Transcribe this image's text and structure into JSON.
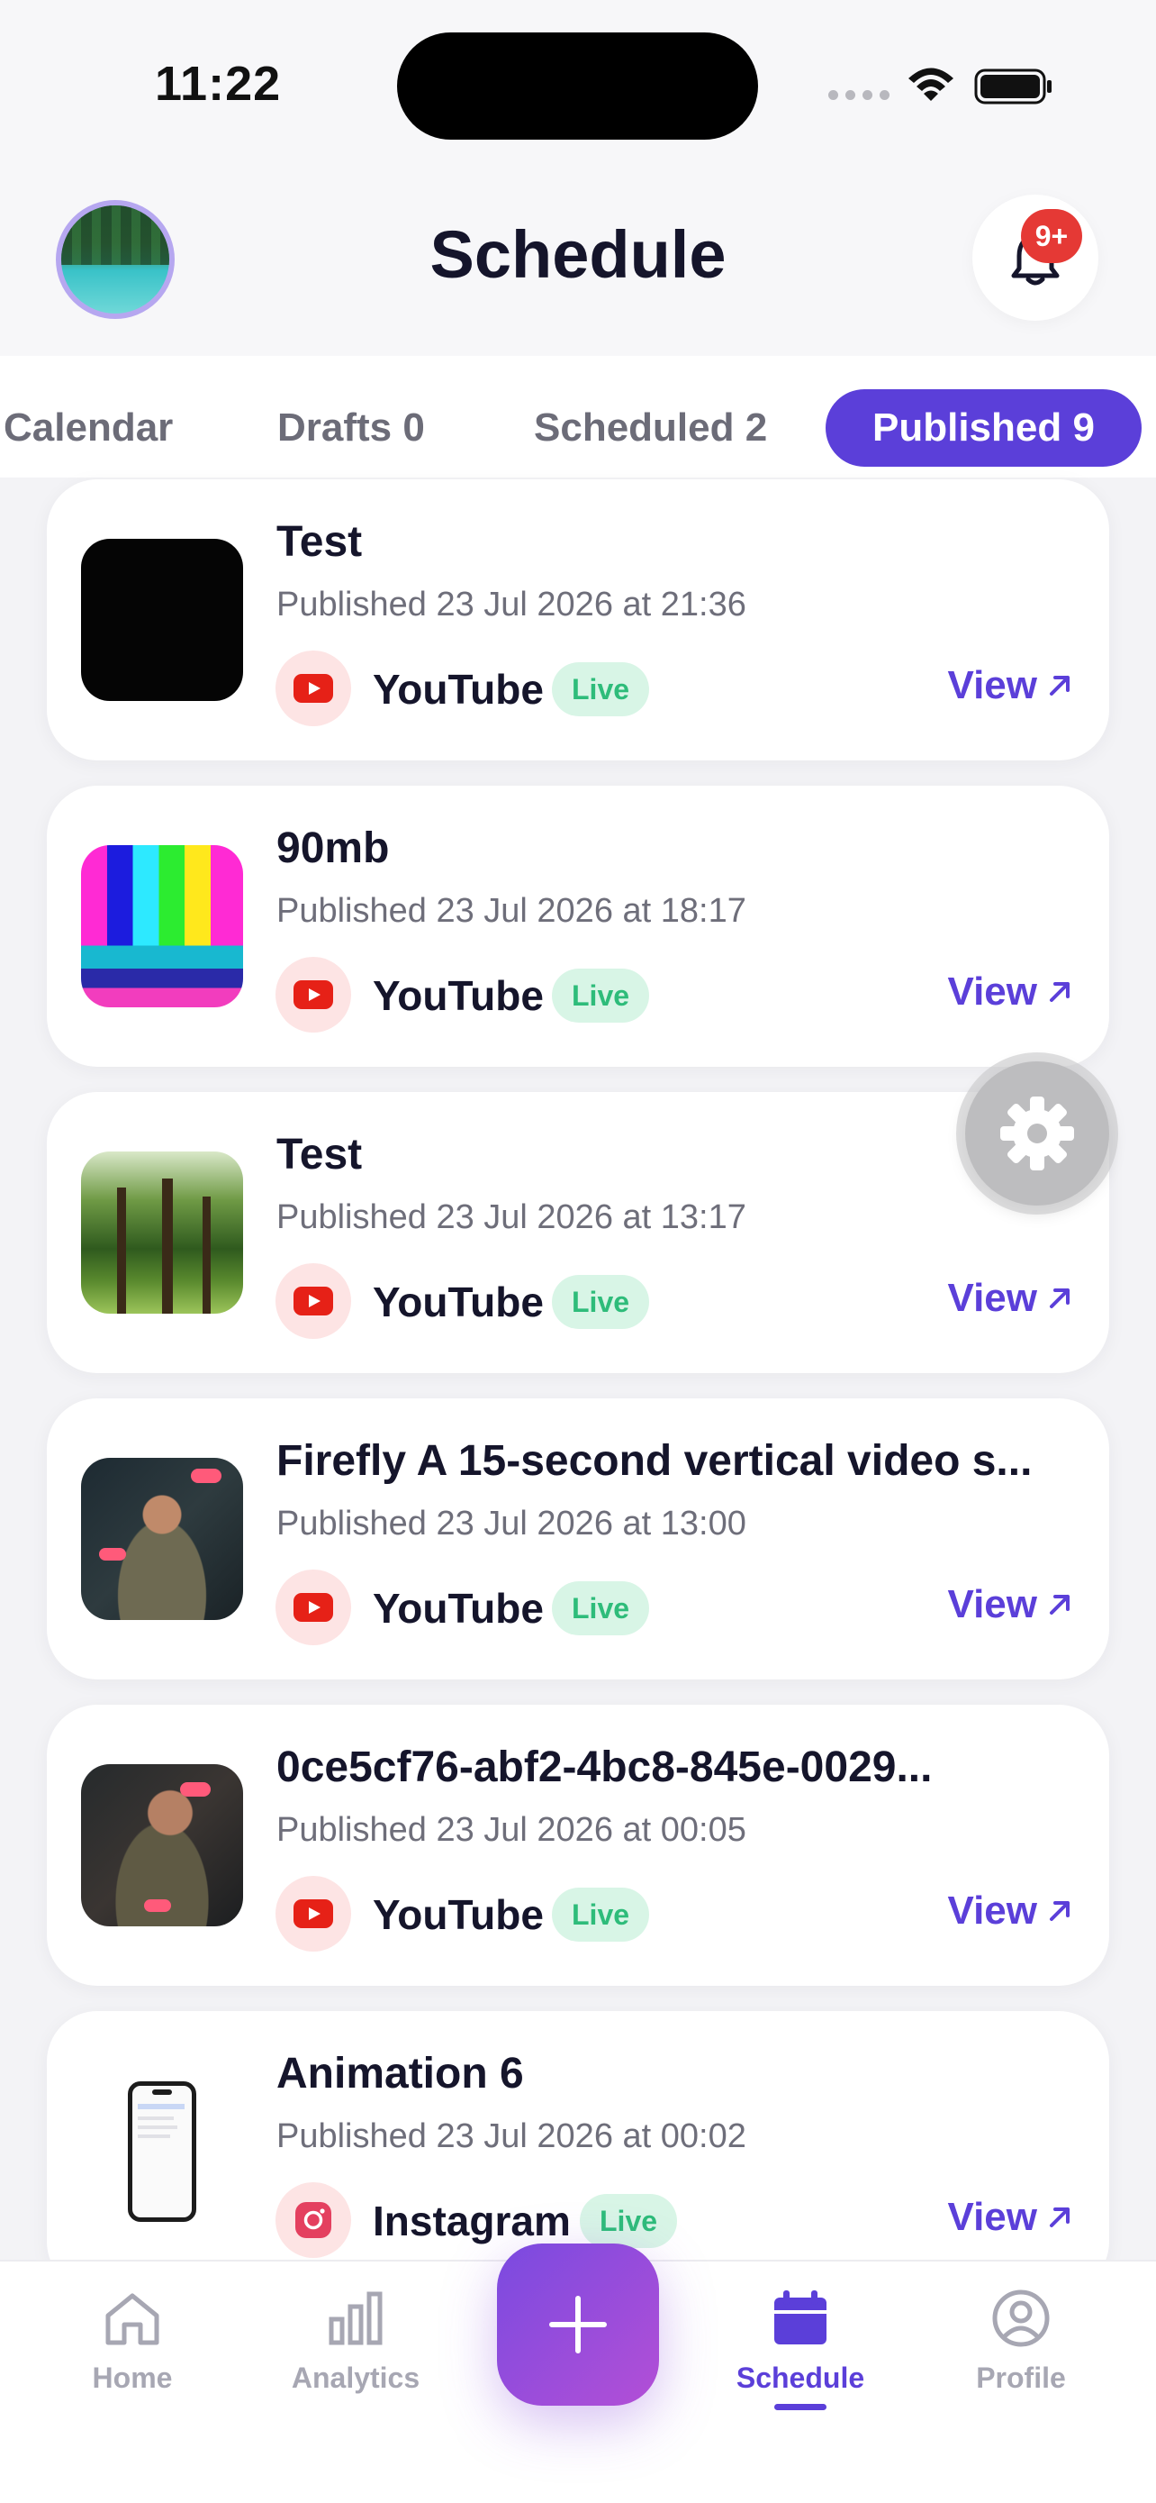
{
  "status_bar": {
    "time": "11:22"
  },
  "header": {
    "title": "Schedule",
    "notification_badge": "9+"
  },
  "tabs": [
    {
      "label": "Calendar",
      "active": false
    },
    {
      "label": "Drafts 0",
      "active": false
    },
    {
      "label": "Scheduled 2",
      "active": false
    },
    {
      "label": "Published 9",
      "active": true
    }
  ],
  "posts": [
    {
      "title": "Test",
      "date": "Published 23 Jul 2026 at 21:36",
      "platform": "YouTube",
      "status": "Live",
      "action": "View"
    },
    {
      "title": "90mb",
      "date": "Published 23 Jul 2026 at 18:17",
      "platform": "YouTube",
      "status": "Live",
      "action": "View"
    },
    {
      "title": "Test",
      "date": "Published 23 Jul 2026 at 13:17",
      "platform": "YouTube",
      "status": "Live",
      "action": "View"
    },
    {
      "title": "Firefly A 15-second vertical video s...",
      "date": "Published 23 Jul 2026 at 13:00",
      "platform": "YouTube",
      "status": "Live",
      "action": "View"
    },
    {
      "title": "0ce5cf76-abf2-4bc8-845e-0029...",
      "date": "Published 23 Jul 2026 at 00:05",
      "platform": "YouTube",
      "status": "Live",
      "action": "View"
    },
    {
      "title": "Animation 6",
      "date": "Published 23 Jul 2026 at 00:02",
      "platform": "Instagram",
      "status": "Live",
      "action": "View"
    }
  ],
  "bottom_nav": [
    {
      "label": "Home",
      "icon": "home-icon"
    },
    {
      "label": "Analytics",
      "icon": "analytics-icon"
    },
    {
      "label": "Schedule",
      "icon": "calendar-icon",
      "active": true
    },
    {
      "label": "Profile",
      "icon": "profile-icon"
    }
  ],
  "colors": {
    "accent": "#5b3fd9",
    "live_bg": "#d8f5e6",
    "live_text": "#2ebc7a",
    "youtube": "#e62117"
  }
}
